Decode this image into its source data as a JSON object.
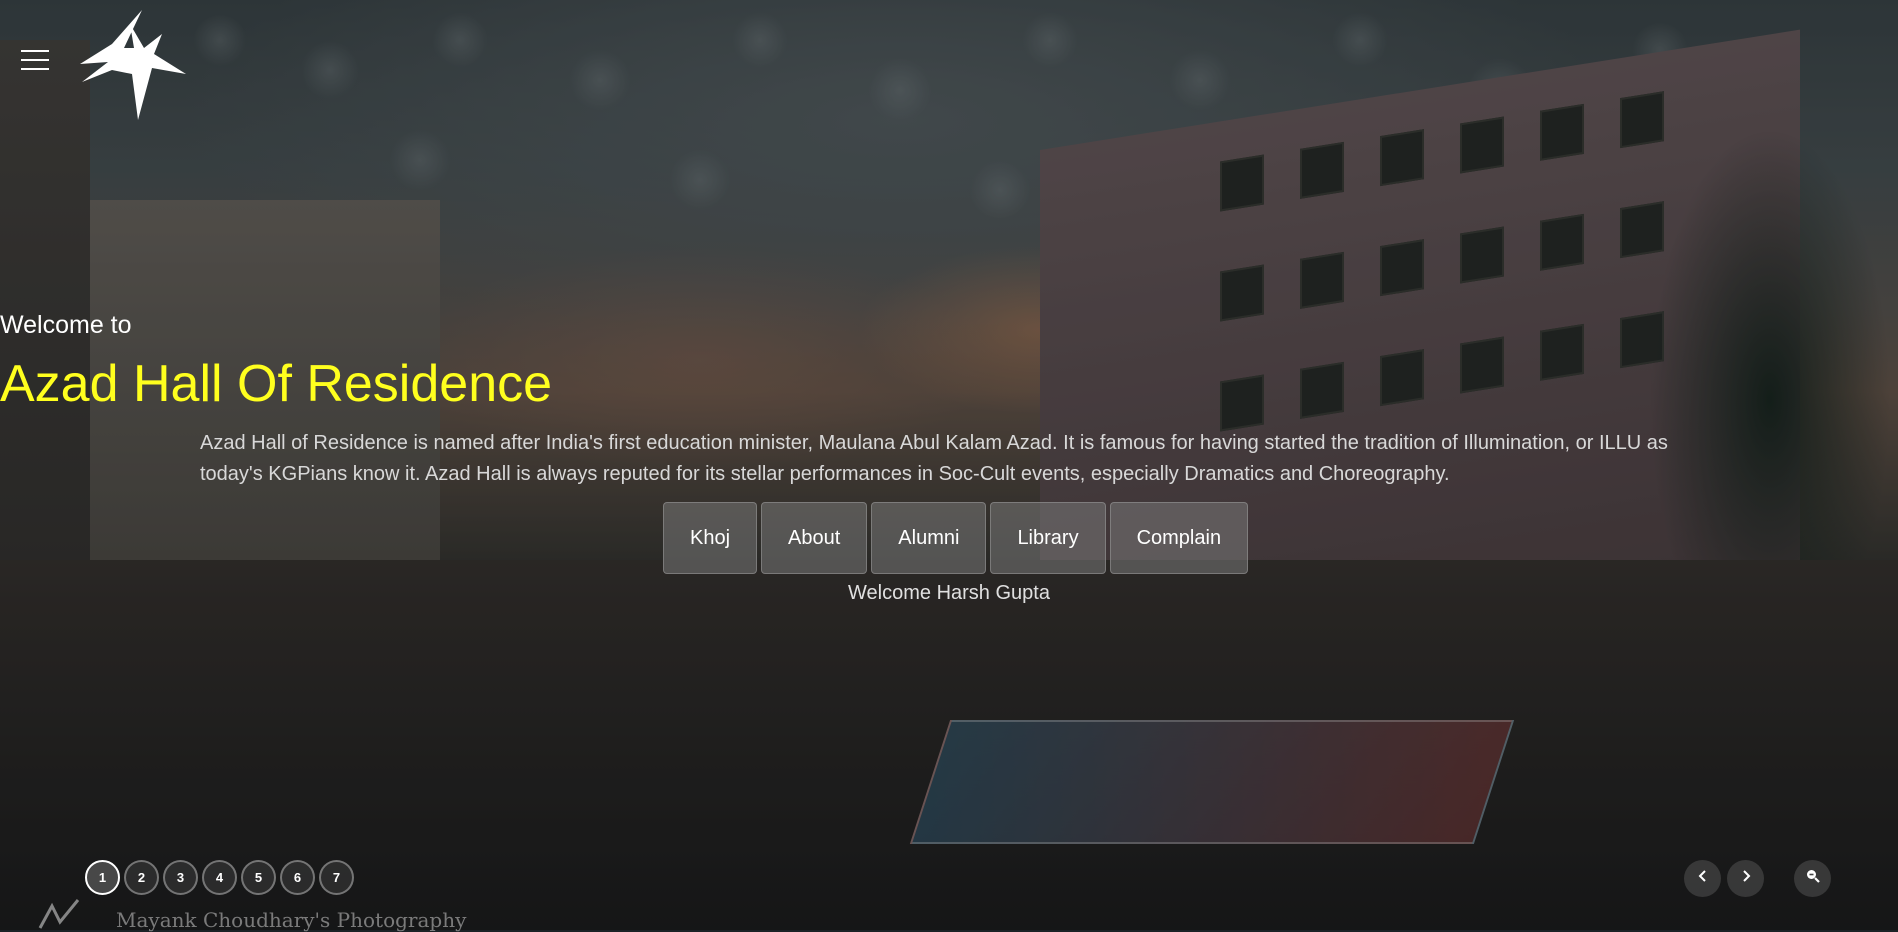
{
  "header": {
    "menu_icon": "hamburger-menu-icon",
    "logo_icon": "azad-hall-logo-icon"
  },
  "hero": {
    "welcome": "Welcome to",
    "title": "Azad Hall Of Residence",
    "description": "Azad Hall of Residence is named after India's first education minister, Maulana Abul Kalam Azad. It is famous for having started the tradition of Illumination, or ILLU as today's KGPians know it. Azad Hall is always reputed for its stellar performances in Soc-Cult events, especially Dramatics and Choreography.",
    "title_color": "#ffff1e",
    "buttons": [
      {
        "label": "Khoj"
      },
      {
        "label": "About"
      },
      {
        "label": "Alumni"
      },
      {
        "label": "Library"
      },
      {
        "label": "Complain"
      }
    ],
    "user_greeting": "Welcome Harsh Gupta"
  },
  "slider": {
    "slides": [
      "1",
      "2",
      "3",
      "4",
      "5",
      "6",
      "7"
    ],
    "active_slide": "1",
    "controls": {
      "prev_icon": "chevron-left-icon",
      "next_icon": "chevron-right-icon",
      "zoom_icon": "zoom-out-icon"
    }
  },
  "photo_credit": "Mayank Choudhary's Photography"
}
